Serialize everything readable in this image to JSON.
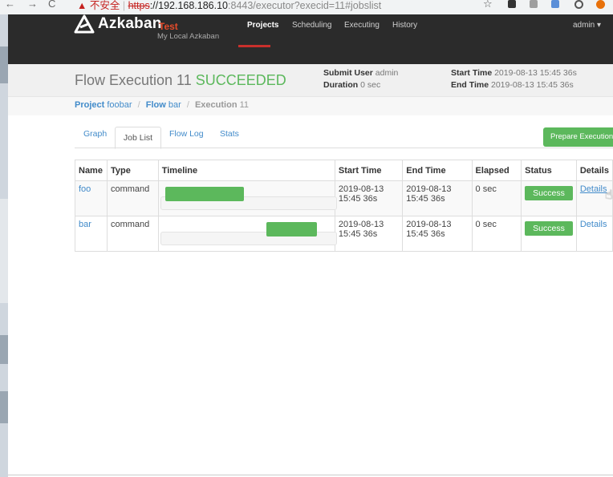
{
  "browser": {
    "back_glyph": "←",
    "forward_glyph": "→",
    "reload_glyph": "C",
    "warning_glyph": "▲",
    "security_text": "不安全",
    "protocol": "https",
    "host": "://192.168.186.10",
    "path": ":8443/executor?execid=11#jobslist",
    "star_glyph": "☆"
  },
  "nav": {
    "brand": "Azkaban",
    "env_name": "Test",
    "env_desc": "My Local Azkaban",
    "links": [
      "Projects",
      "Scheduling",
      "Executing",
      "History"
    ],
    "active": "Projects",
    "user": "admin ▾"
  },
  "header": {
    "title_prefix": "Flow Execution 11",
    "status": "SUCCEEDED",
    "submit_user_label": "Submit User",
    "submit_user": "admin",
    "duration_label": "Duration",
    "duration": "0 sec",
    "start_time_label": "Start Time",
    "start_time": "2019-08-13 15:45 36s",
    "end_time_label": "End Time",
    "end_time": "2019-08-13 15:45 36s"
  },
  "breadcrumb": {
    "project_label": "Project",
    "project": "foobar",
    "flow_label": "Flow",
    "flow": "bar",
    "execution_label": "Execution",
    "execution": "11",
    "separator": "/"
  },
  "tabs": [
    "Graph",
    "Job List",
    "Flow Log",
    "Stats"
  ],
  "active_tab": "Job List",
  "prepare_button": "Prepare Execution",
  "table": {
    "columns": [
      "Name",
      "Type",
      "Timeline",
      "Start Time",
      "End Time",
      "Elapsed",
      "Status",
      "Details"
    ],
    "rows": [
      {
        "name": "foo",
        "type": "command",
        "timeline_start": 0.0,
        "timeline_end": 0.45,
        "start_date": "2019-08-13",
        "start_clock": "15:45 36s",
        "end_date": "2019-08-13",
        "end_clock": "15:45 36s",
        "elapsed": "0 sec",
        "status": "Success",
        "details": "Details"
      },
      {
        "name": "bar",
        "type": "command",
        "timeline_start": 0.58,
        "timeline_end": 0.87,
        "start_date": "2019-08-13",
        "start_clock": "15:45 36s",
        "end_date": "2019-08-13",
        "end_clock": "15:45 36s",
        "elapsed": "0 sec",
        "status": "Success",
        "details": "Details"
      }
    ]
  },
  "colors": {
    "success": "#5cb85c",
    "link": "#428bca",
    "navbar": "#2b2b2b",
    "env_accent": "#e44b2b"
  }
}
